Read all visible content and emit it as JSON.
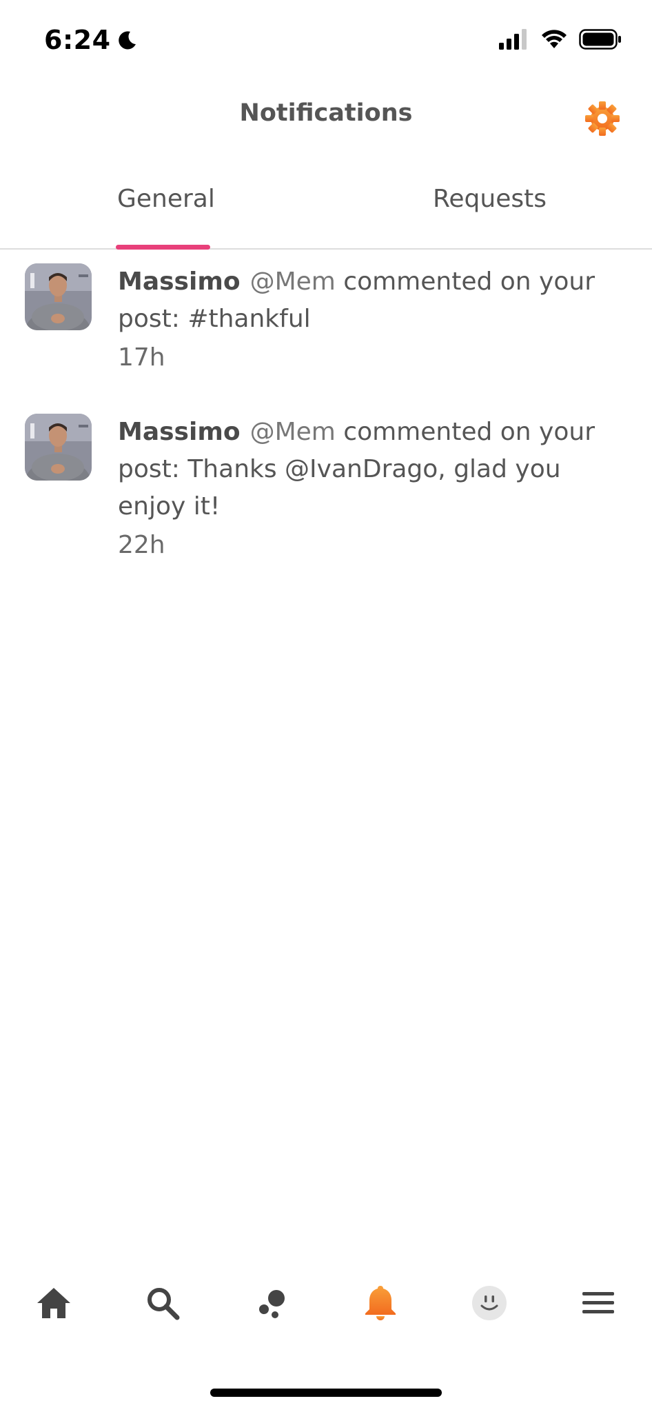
{
  "status_bar": {
    "time": "6:24",
    "icons": [
      "moon-icon",
      "cellular-signal-icon",
      "wifi-icon",
      "battery-icon"
    ]
  },
  "header": {
    "title": "Notifications",
    "settings_icon": "gear-icon",
    "accent_color": "#f58a2b"
  },
  "tabs": [
    {
      "label": "General",
      "active": true
    },
    {
      "label": "Requests",
      "active": false
    }
  ],
  "tab_indicator_color": "#e8407a",
  "notifications": [
    {
      "name": "Massimo",
      "handle": "@Mem",
      "text": "commented on your post: #thankful",
      "time": "17h"
    },
    {
      "name": "Massimo",
      "handle": "@Mem",
      "text": "commented on your post: Thanks @IvanDrago, glad you enjoy it!",
      "time": "22h"
    }
  ],
  "bottom_nav": {
    "items": [
      {
        "icon": "home-icon",
        "active": false
      },
      {
        "icon": "search-icon",
        "active": false
      },
      {
        "icon": "bubbles-icon",
        "active": false
      },
      {
        "icon": "bell-icon",
        "active": true
      },
      {
        "icon": "smiley-profile-icon",
        "active": false
      },
      {
        "icon": "menu-icon",
        "active": false
      }
    ],
    "active_color": "#f58a2b",
    "inactive_color": "#444444"
  }
}
